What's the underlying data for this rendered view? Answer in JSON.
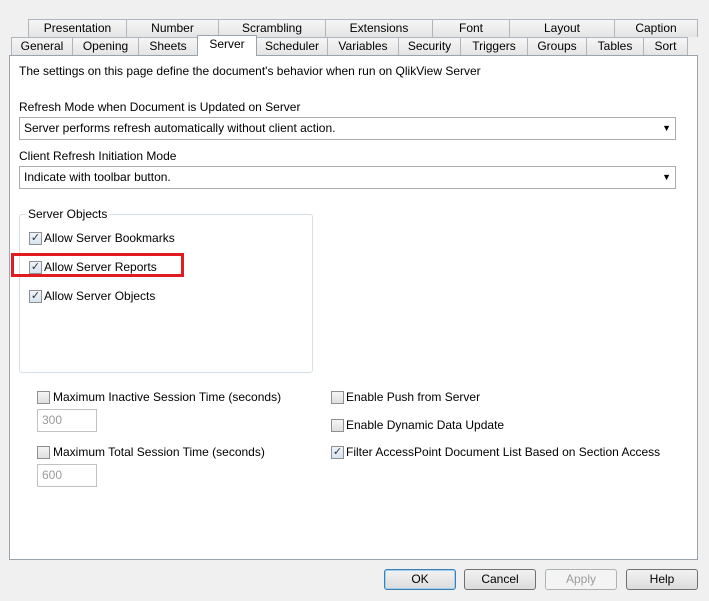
{
  "tabs_row1": [
    "Presentation",
    "Number",
    "Scrambling",
    "Extensions",
    "Font",
    "Layout",
    "Caption"
  ],
  "tabs_row2": [
    "General",
    "Opening",
    "Sheets",
    "Server",
    "Scheduler",
    "Variables",
    "Security",
    "Triggers",
    "Groups",
    "Tables",
    "Sort"
  ],
  "active_tab": "Server",
  "description": "The settings on this page define the document's behavior when run on QlikView Server",
  "refresh_mode": {
    "label": "Refresh Mode when Document is Updated on Server",
    "value": "Server performs refresh automatically without client action."
  },
  "client_refresh": {
    "label": "Client Refresh Initiation Mode",
    "value": "Indicate with toolbar button."
  },
  "server_objects": {
    "title": "Server Objects",
    "items": [
      {
        "label": "Allow Server Bookmarks",
        "checked": true
      },
      {
        "label": "Allow Server Reports",
        "checked": true
      },
      {
        "label": "Allow Server Objects",
        "checked": true
      }
    ]
  },
  "session": {
    "max_inactive_label": "Maximum Inactive Session Time (seconds)",
    "max_inactive_value": "300",
    "max_total_label": "Maximum Total Session Time (seconds)",
    "max_total_value": "600"
  },
  "options": {
    "push_label": "Enable Push from Server",
    "dynamic_label": "Enable Dynamic Data Update",
    "filter_label": "Filter AccessPoint Document List Based on Section Access"
  },
  "buttons": {
    "ok": "OK",
    "cancel": "Cancel",
    "apply": "Apply",
    "help": "Help"
  },
  "colors": {
    "highlight": "#e11b22"
  }
}
